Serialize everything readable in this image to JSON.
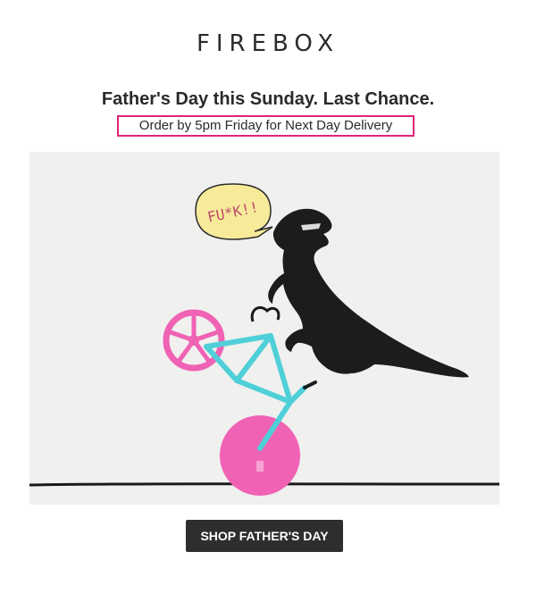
{
  "brand": {
    "logo_text": "FIREBOX"
  },
  "hero": {
    "headline": "Father's Day this Sunday. Last Chance.",
    "delivery_notice": "Order by 5pm Friday for Next Day Delivery",
    "speech_bubble_text": "FU*K!!"
  },
  "cta": {
    "label": "SHOP FATHER'S DAY"
  },
  "colors": {
    "accent_border": "#e0247a",
    "button_bg": "#2e2e2e",
    "bike_frame": "#4fd0d8",
    "bike_wheel": "#f062b4",
    "dinosaur": "#1c1b1d",
    "speech_bubble": "#f7eb9a"
  },
  "icons": {
    "product_image": "dinosaur-riding-pizza-cutter-bicycle"
  }
}
